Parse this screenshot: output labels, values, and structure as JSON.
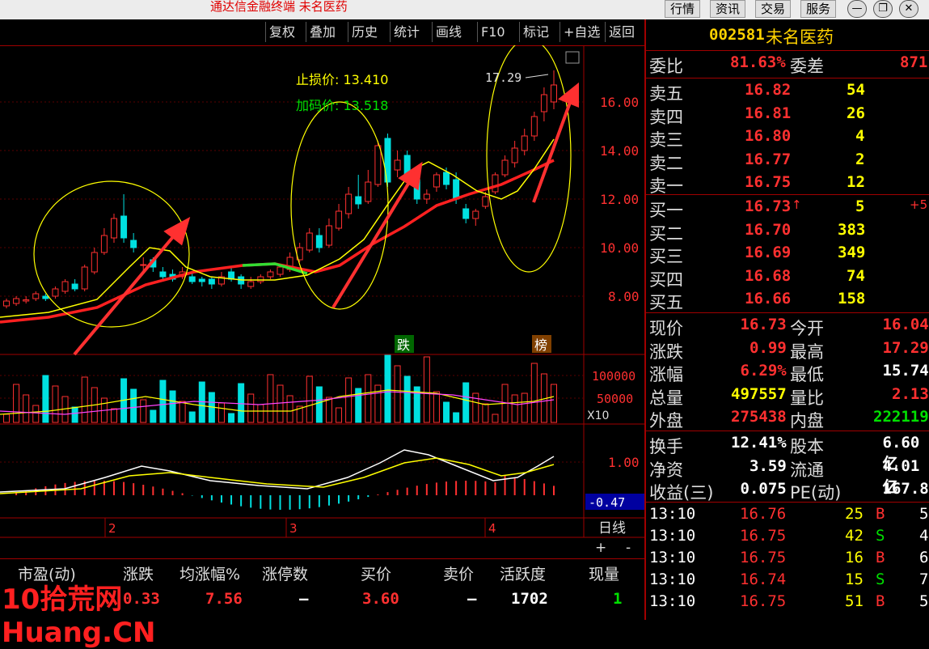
{
  "window": {
    "title": "通达信金融终端  未名医药",
    "menu": [
      "行情",
      "资讯",
      "交易",
      "服务"
    ],
    "controls": [
      "—",
      "❐",
      "✕"
    ]
  },
  "toolbar": {
    "buttons": [
      "复权",
      "叠加",
      "历史",
      "统计",
      "画线",
      "F10",
      "标记",
      "+自选",
      "返回"
    ]
  },
  "chart": {
    "stop_loss": "止损价: 13.410",
    "add_price": "加码价: 13.518",
    "high_label": "17.29",
    "price_ticks": [
      "16.00",
      "14.00",
      "12.00",
      "10.00",
      "8.00"
    ],
    "vol_ticks": [
      "100000",
      "50000"
    ],
    "vol_unit": "X10",
    "macd_tick": "1.00",
    "macd_value": "-0.47",
    "month_labels": [
      "2",
      "3",
      "4"
    ],
    "badge_die": "跌",
    "badge_bang": "榜",
    "period": "日线",
    "zoom_in": "+",
    "zoom_out": "-"
  },
  "quote": {
    "code": "002581",
    "name": "未名医药",
    "weibi_label": "委比",
    "weibi": "81.63%",
    "weicha_label": "委差",
    "weicha": "871",
    "asks": [
      {
        "label": "卖五",
        "price": "16.82",
        "vol": "54"
      },
      {
        "label": "卖四",
        "price": "16.81",
        "vol": "26"
      },
      {
        "label": "卖三",
        "price": "16.80",
        "vol": "4"
      },
      {
        "label": "卖二",
        "price": "16.77",
        "vol": "2"
      },
      {
        "label": "卖一",
        "price": "16.75",
        "vol": "12"
      }
    ],
    "bids": [
      {
        "label": "买一",
        "price": "16.73",
        "vol": "5",
        "chg": "+5"
      },
      {
        "label": "买二",
        "price": "16.70",
        "vol": "383",
        "chg": ""
      },
      {
        "label": "买三",
        "price": "16.69",
        "vol": "349",
        "chg": ""
      },
      {
        "label": "买四",
        "price": "16.68",
        "vol": "74",
        "chg": ""
      },
      {
        "label": "买五",
        "price": "16.66",
        "vol": "158",
        "chg": ""
      }
    ],
    "stats": [
      {
        "l1": "现价",
        "v1": "16.73",
        "l2": "今开",
        "v2": "16.04"
      },
      {
        "l1": "涨跌",
        "v1": "0.99",
        "l2": "最高",
        "v2": "17.29"
      },
      {
        "l1": "涨幅",
        "v1": "6.29%",
        "l2": "最低",
        "v2": "15.74"
      },
      {
        "l1": "总量",
        "v1": "497557",
        "l2": "量比",
        "v2": "2.13"
      },
      {
        "l1": "外盘",
        "v1": "275438",
        "l2": "内盘",
        "v2": "222119"
      }
    ],
    "fund": [
      {
        "l1": "换手",
        "v1": "12.41%",
        "l2": "股本",
        "v2": "6.60亿"
      },
      {
        "l1": "净资",
        "v1": "3.59",
        "l2": "流通",
        "v2": "4.01亿"
      },
      {
        "l1": "收益(三)",
        "v1": "0.075",
        "l2": "PE(动)",
        "v2": "167.8"
      }
    ],
    "ticks": [
      {
        "time": "13:10",
        "price": "16.76",
        "vol": "25",
        "side": "B",
        "n": "5"
      },
      {
        "time": "13:10",
        "price": "16.75",
        "vol": "42",
        "side": "S",
        "n": "4"
      },
      {
        "time": "13:10",
        "price": "16.75",
        "vol": "16",
        "side": "B",
        "n": "6"
      },
      {
        "time": "13:10",
        "price": "16.74",
        "vol": "15",
        "side": "S",
        "n": "7"
      },
      {
        "time": "13:10",
        "price": "16.75",
        "vol": "51",
        "side": "B",
        "n": "5"
      }
    ]
  },
  "bottom": {
    "headers": [
      "市盈(动)",
      "涨跌",
      "均涨幅%",
      "涨停数",
      "买价",
      "卖价",
      "活跃度",
      "现量"
    ],
    "values": [
      "",
      "0.33",
      "7.56",
      "–",
      "3.60",
      "–",
      "1702",
      "1"
    ]
  },
  "watermark": "10拾荒网 Huang.CN",
  "colors": {
    "up": "#ff3030",
    "down": "#00e0e0",
    "ma5": "#ffff00",
    "ma20": "#ff2020",
    "gold": "#ffd200"
  }
}
